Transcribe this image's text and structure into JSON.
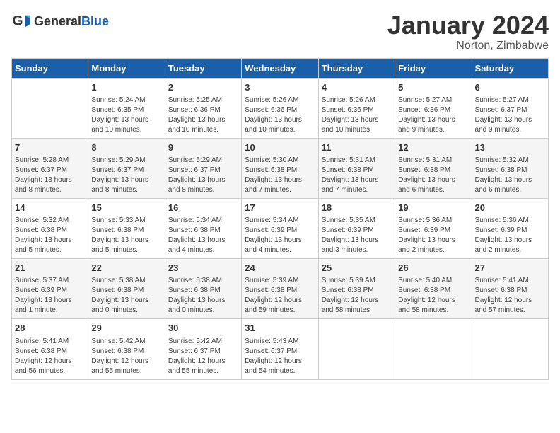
{
  "header": {
    "logo_general": "General",
    "logo_blue": "Blue",
    "title": "January 2024",
    "subtitle": "Norton, Zimbabwe"
  },
  "weekdays": [
    "Sunday",
    "Monday",
    "Tuesday",
    "Wednesday",
    "Thursday",
    "Friday",
    "Saturday"
  ],
  "weeks": [
    [
      {
        "day": "",
        "info": ""
      },
      {
        "day": "1",
        "info": "Sunrise: 5:24 AM\nSunset: 6:35 PM\nDaylight: 13 hours\nand 10 minutes."
      },
      {
        "day": "2",
        "info": "Sunrise: 5:25 AM\nSunset: 6:36 PM\nDaylight: 13 hours\nand 10 minutes."
      },
      {
        "day": "3",
        "info": "Sunrise: 5:26 AM\nSunset: 6:36 PM\nDaylight: 13 hours\nand 10 minutes."
      },
      {
        "day": "4",
        "info": "Sunrise: 5:26 AM\nSunset: 6:36 PM\nDaylight: 13 hours\nand 10 minutes."
      },
      {
        "day": "5",
        "info": "Sunrise: 5:27 AM\nSunset: 6:36 PM\nDaylight: 13 hours\nand 9 minutes."
      },
      {
        "day": "6",
        "info": "Sunrise: 5:27 AM\nSunset: 6:37 PM\nDaylight: 13 hours\nand 9 minutes."
      }
    ],
    [
      {
        "day": "7",
        "info": "Sunrise: 5:28 AM\nSunset: 6:37 PM\nDaylight: 13 hours\nand 8 minutes."
      },
      {
        "day": "8",
        "info": "Sunrise: 5:29 AM\nSunset: 6:37 PM\nDaylight: 13 hours\nand 8 minutes."
      },
      {
        "day": "9",
        "info": "Sunrise: 5:29 AM\nSunset: 6:37 PM\nDaylight: 13 hours\nand 8 minutes."
      },
      {
        "day": "10",
        "info": "Sunrise: 5:30 AM\nSunset: 6:38 PM\nDaylight: 13 hours\nand 7 minutes."
      },
      {
        "day": "11",
        "info": "Sunrise: 5:31 AM\nSunset: 6:38 PM\nDaylight: 13 hours\nand 7 minutes."
      },
      {
        "day": "12",
        "info": "Sunrise: 5:31 AM\nSunset: 6:38 PM\nDaylight: 13 hours\nand 6 minutes."
      },
      {
        "day": "13",
        "info": "Sunrise: 5:32 AM\nSunset: 6:38 PM\nDaylight: 13 hours\nand 6 minutes."
      }
    ],
    [
      {
        "day": "14",
        "info": "Sunrise: 5:32 AM\nSunset: 6:38 PM\nDaylight: 13 hours\nand 5 minutes."
      },
      {
        "day": "15",
        "info": "Sunrise: 5:33 AM\nSunset: 6:38 PM\nDaylight: 13 hours\nand 5 minutes."
      },
      {
        "day": "16",
        "info": "Sunrise: 5:34 AM\nSunset: 6:38 PM\nDaylight: 13 hours\nand 4 minutes."
      },
      {
        "day": "17",
        "info": "Sunrise: 5:34 AM\nSunset: 6:39 PM\nDaylight: 13 hours\nand 4 minutes."
      },
      {
        "day": "18",
        "info": "Sunrise: 5:35 AM\nSunset: 6:39 PM\nDaylight: 13 hours\nand 3 minutes."
      },
      {
        "day": "19",
        "info": "Sunrise: 5:36 AM\nSunset: 6:39 PM\nDaylight: 13 hours\nand 2 minutes."
      },
      {
        "day": "20",
        "info": "Sunrise: 5:36 AM\nSunset: 6:39 PM\nDaylight: 13 hours\nand 2 minutes."
      }
    ],
    [
      {
        "day": "21",
        "info": "Sunrise: 5:37 AM\nSunset: 6:39 PM\nDaylight: 13 hours\nand 1 minute."
      },
      {
        "day": "22",
        "info": "Sunrise: 5:38 AM\nSunset: 6:38 PM\nDaylight: 13 hours\nand 0 minutes."
      },
      {
        "day": "23",
        "info": "Sunrise: 5:38 AM\nSunset: 6:38 PM\nDaylight: 13 hours\nand 0 minutes."
      },
      {
        "day": "24",
        "info": "Sunrise: 5:39 AM\nSunset: 6:38 PM\nDaylight: 12 hours\nand 59 minutes."
      },
      {
        "day": "25",
        "info": "Sunrise: 5:39 AM\nSunset: 6:38 PM\nDaylight: 12 hours\nand 58 minutes."
      },
      {
        "day": "26",
        "info": "Sunrise: 5:40 AM\nSunset: 6:38 PM\nDaylight: 12 hours\nand 58 minutes."
      },
      {
        "day": "27",
        "info": "Sunrise: 5:41 AM\nSunset: 6:38 PM\nDaylight: 12 hours\nand 57 minutes."
      }
    ],
    [
      {
        "day": "28",
        "info": "Sunrise: 5:41 AM\nSunset: 6:38 PM\nDaylight: 12 hours\nand 56 minutes."
      },
      {
        "day": "29",
        "info": "Sunrise: 5:42 AM\nSunset: 6:38 PM\nDaylight: 12 hours\nand 55 minutes."
      },
      {
        "day": "30",
        "info": "Sunrise: 5:42 AM\nSunset: 6:37 PM\nDaylight: 12 hours\nand 55 minutes."
      },
      {
        "day": "31",
        "info": "Sunrise: 5:43 AM\nSunset: 6:37 PM\nDaylight: 12 hours\nand 54 minutes."
      },
      {
        "day": "",
        "info": ""
      },
      {
        "day": "",
        "info": ""
      },
      {
        "day": "",
        "info": ""
      }
    ]
  ]
}
